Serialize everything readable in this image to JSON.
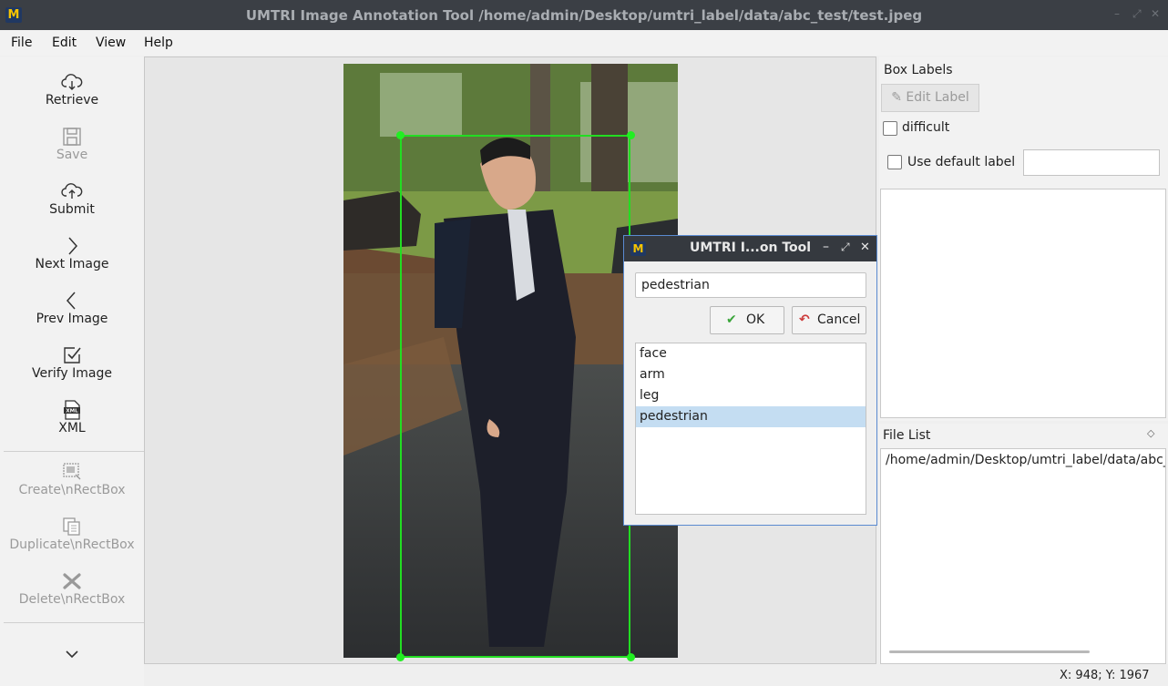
{
  "window": {
    "title": "UMTRI Image Annotation Tool /home/admin/Desktop/umtri_label/data/abc_test/test.jpeg",
    "logo": "M"
  },
  "menu": {
    "file": "File",
    "edit": "Edit",
    "view": "View",
    "help": "Help"
  },
  "toolbar": {
    "retrieve": "Retrieve",
    "save": "Save",
    "submit": "Submit",
    "next_image": "Next Image",
    "prev_image": "Prev Image",
    "verify_image": "Verify Image",
    "xml": "XML",
    "xml_icon_text": "XML",
    "create_rect": "Create\\nRectBox",
    "duplicate_rect": "Duplicate\\nRectBox",
    "delete_rect": "Delete\\nRectBox"
  },
  "box_labels": {
    "title": "Box Labels",
    "edit_label": "Edit Label",
    "difficult": "difficult",
    "use_default": "Use default label",
    "default_value": ""
  },
  "file_list": {
    "title": "File List",
    "items": [
      "/home/admin/Desktop/umtri_label/data/abc_"
    ]
  },
  "dialog": {
    "title": "UMTRI I...on Tool",
    "input_value": "pedestrian",
    "ok": "OK",
    "cancel": "Cancel",
    "labels": [
      "face",
      "arm",
      "leg",
      "pedestrian"
    ],
    "selected": "pedestrian"
  },
  "status": {
    "coords": "X: 948; Y: 1967"
  },
  "colors": {
    "bbox": "#22dd22",
    "title_bg": "#3b3f45",
    "selection": "#c4ddf2",
    "accent_border": "#5a8ad0"
  }
}
